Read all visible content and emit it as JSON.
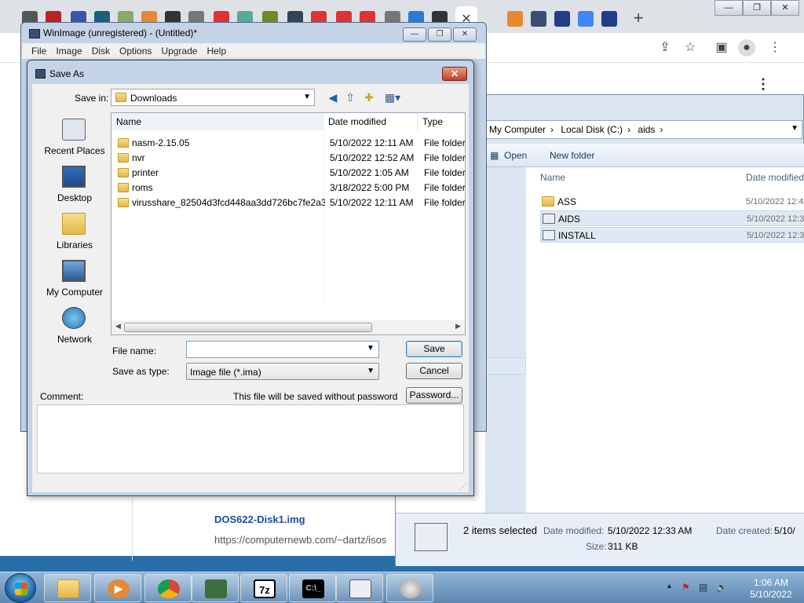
{
  "browser": {
    "search_result_title": "DOS622-Disk1.img",
    "search_result_url": "https://computernewb.com/~dartz/isos"
  },
  "explorer": {
    "breadcrumb": [
      "My Computer",
      "Local Disk (C:)",
      "aids"
    ],
    "toolbar": {
      "open": "Open",
      "new_folder": "New folder"
    },
    "columns": {
      "name": "Name",
      "date": "Date modified"
    },
    "items": [
      {
        "name": "ASS",
        "date": "5/10/2022 12:4"
      },
      {
        "name": "AIDS",
        "date": "5/10/2022 12:3"
      },
      {
        "name": "INSTALL",
        "date": "5/10/2022 12:3"
      }
    ],
    "details": {
      "count": "2 items selected",
      "date_label": "Date modified:",
      "date_value": "5/10/2022 12:33 AM",
      "created_label": "Date created:",
      "created_value": "5/10/",
      "size_label": "Size:",
      "size_value": "311 KB"
    }
  },
  "winimage": {
    "title": "WinImage (unregistered) - (Untitled)*",
    "menu": [
      "File",
      "Image",
      "Disk",
      "Options",
      "Upgrade",
      "Help"
    ]
  },
  "saveas": {
    "title": "Save As",
    "save_in_label": "Save in:",
    "save_in_value": "Downloads",
    "places": [
      "Recent Places",
      "Desktop",
      "Libraries",
      "My Computer",
      "Network"
    ],
    "columns": {
      "name": "Name",
      "date": "Date modified",
      "type": "Type"
    },
    "files": [
      {
        "name": "nasm-2.15.05",
        "date": "5/10/2022 12:11 AM",
        "type": "File folder"
      },
      {
        "name": "nvr",
        "date": "5/10/2022 12:52 AM",
        "type": "File folder"
      },
      {
        "name": "printer",
        "date": "5/10/2022 1:05 AM",
        "type": "File folder"
      },
      {
        "name": "roms",
        "date": "3/18/2022 5:00 PM",
        "type": "File folder"
      },
      {
        "name": "virusshare_82504d3fcd448aa3dd726bc7fe2a3...",
        "date": "5/10/2022 12:11 AM",
        "type": "File folder"
      }
    ],
    "filename_label": "File name:",
    "filename_value": "",
    "type_label": "Save as type:",
    "type_value": "Image file (*.ima)",
    "save_button": "Save",
    "cancel_button": "Cancel",
    "password_button": "Password...",
    "comment_label": "Comment:",
    "password_note": "This file will be saved without password"
  },
  "taskbar": {
    "time": "1:06 AM",
    "date": "5/10/2022",
    "app_7zip": "7z"
  }
}
